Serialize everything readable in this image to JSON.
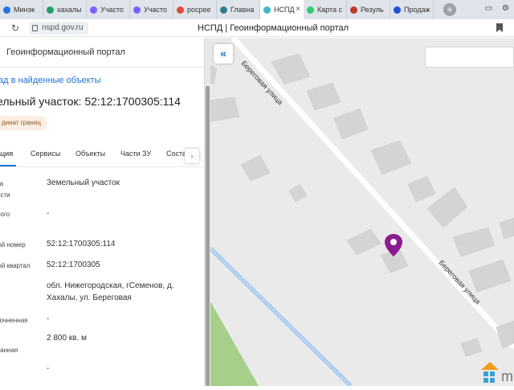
{
  "browser": {
    "tabs": [
      {
        "label": "Минэк",
        "color": "#1a73e8"
      },
      {
        "label": "хахалы",
        "color": "#21a366"
      },
      {
        "label": "Участо",
        "color": "#7b61ff"
      },
      {
        "label": "Участо",
        "color": "#7b61ff"
      },
      {
        "label": "росрее",
        "color": "#e24a3b"
      },
      {
        "label": "Главна",
        "color": "#2e7d8c"
      },
      {
        "label": "НСПД",
        "color": "#3fb8c8",
        "active": true
      },
      {
        "label": "Карта с",
        "color": "#2ecc71"
      },
      {
        "label": "Резуль",
        "color": "#c0392b"
      },
      {
        "label": "Продаж",
        "color": "#1f4fd8"
      }
    ],
    "close_glyph": "×",
    "new_tab_glyph": "+",
    "url": "nspd.gov.ru",
    "page_title": "НСПД | Геоинформационный портал"
  },
  "panel": {
    "portal_title": "Геоинформационный портал",
    "back_link": "ад в найденные объекты",
    "parcel_title": "ельный участок: 52:12:1700305:114",
    "chip": "динат границ",
    "tabs": [
      "ация",
      "Сервисы",
      "Объекты",
      "Части ЗУ",
      "Соста"
    ],
    "next_glyph": "›",
    "rows": [
      {
        "label1": "та",
        "label2": "ости",
        "value": "Земельный участок"
      },
      {
        "label1": "ного",
        "label2": "",
        "value": "-"
      },
      {
        "label1": "ый номер",
        "label2": "",
        "value": "52:12:1700305:114"
      },
      {
        "label1": "ый квартал",
        "label2": "",
        "value": "52:12:1700305"
      },
      {
        "label1": "",
        "label2": "",
        "value": "обл. Нижегородская, гСеменов, д. Хахалы, ул. Береговая"
      },
      {
        "label1": "точненная",
        "label2": "",
        "value": "-"
      },
      {
        "label1": "ванная",
        "label2": "",
        "value": "2 800 кв. м"
      },
      {
        "label1": "",
        "label2": "",
        "value": "-"
      }
    ]
  },
  "map": {
    "collapse_glyph": "«",
    "street_label_1": "Береговая улица",
    "street_label_2": "Береговая улица",
    "road_color": "#ffffff",
    "building_color": "#d4d4d4",
    "water_color": "#9fc7ee",
    "green_color": "#a6cf8a",
    "marker_color": "#8a1c8f",
    "logo_text": "m"
  }
}
